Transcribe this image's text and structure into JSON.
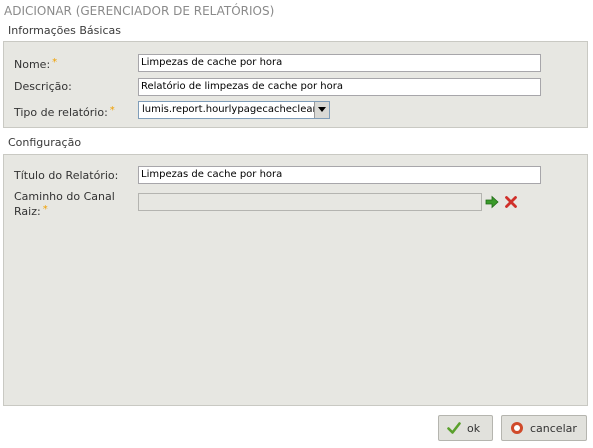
{
  "window": {
    "title": "ADICIONAR (GERENCIADOR DE RELATÓRIOS)"
  },
  "basic": {
    "header": "Informações Básicas",
    "name_label": "Nome:",
    "name_value": "Limpezas de cache por hora",
    "description_label": "Descrição:",
    "description_value": "Relatório de limpezas de cache por hora",
    "type_label": "Tipo de relatório:",
    "type_value": "lumis.report.hourlypagecacheclear"
  },
  "config": {
    "header": "Configuração",
    "report_title_label": "Título do Relatório:",
    "report_title_value": "Limpezas de cache por hora",
    "root_channel_label_line1": "Caminho do Canal",
    "root_channel_label_line2": "Raiz:",
    "root_channel_value": ""
  },
  "required_mark": "*",
  "buttons": {
    "ok_label": "ok",
    "cancel_label": "cancelar"
  },
  "colors": {
    "required": "#f0a000",
    "panel": "#e7e7e2",
    "ok_check": "#5aa02c",
    "cancel_icon": "#d04a2a",
    "select_arrow": "#3a9a2a",
    "clear_x": "#d0302a"
  },
  "icons": [
    "select-arrow-icon",
    "clear-x-icon",
    "check-icon",
    "cancel-circle-icon"
  ]
}
